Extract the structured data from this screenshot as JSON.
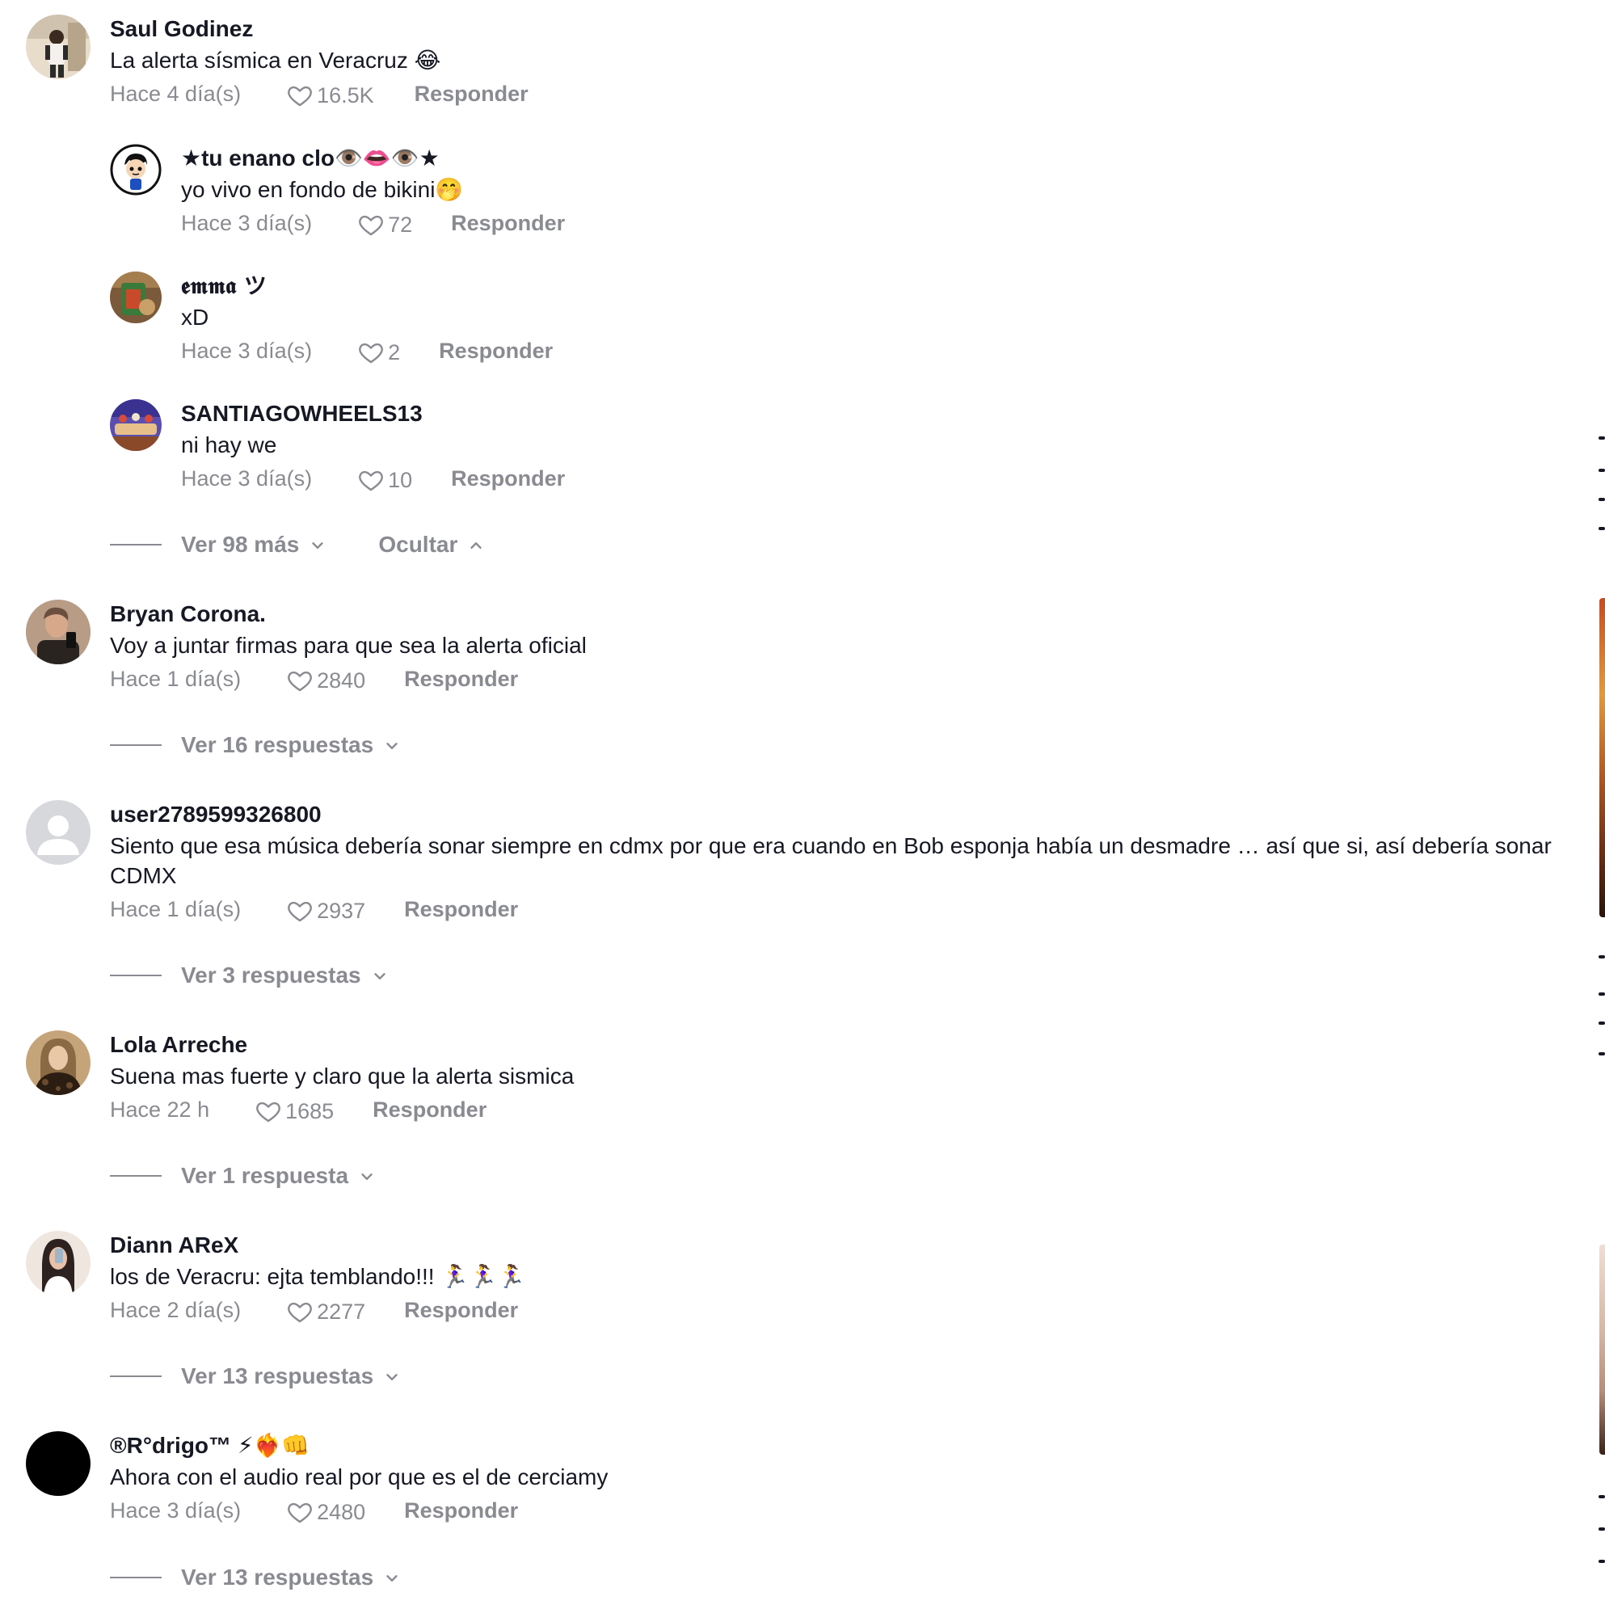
{
  "comments": [
    {
      "username": "Saul Godinez",
      "text": "La alerta sísmica en Veracruz 😂",
      "time": "Hace 4 día(s)",
      "likes": "16.5K",
      "reply_label": "Responder",
      "avatar": {
        "type": "photo",
        "colors": [
          "#d8c3a8",
          "#3b3b3b",
          "#f2efe9"
        ]
      },
      "replies": [
        {
          "username": "★tu enano clo👁️👄👁️★",
          "text": "yo vivo en fondo de bikini🤭",
          "time": "Hace 3 día(s)",
          "likes": "72",
          "reply_label": "Responder",
          "avatar": {
            "type": "cartoon",
            "colors": [
              "#ffffff",
              "#111111",
              "#1d4fbf"
            ]
          }
        },
        {
          "username": "𝖊𝖒𝖒𝖆 ツ",
          "text": "xD",
          "time": "Hace 3 día(s)",
          "likes": "2",
          "reply_label": "Responder",
          "avatar": {
            "type": "photo",
            "colors": [
              "#7a5a3a",
              "#3a7a3a",
              "#c9a06a"
            ]
          }
        },
        {
          "username": "SANTIAGOWHEELS13",
          "text": "ni hay we",
          "time": "Hace 3 día(s)",
          "likes": "10",
          "reply_label": "Responder",
          "avatar": {
            "type": "photo",
            "colors": [
              "#5a4fb0",
              "#d84a3a",
              "#e7c089"
            ]
          }
        }
      ],
      "view_more_label": "Ver 98 más",
      "hide_label": "Ocultar"
    },
    {
      "username": "Bryan Corona.",
      "text": "Voy a juntar firmas para que sea la alerta oficial",
      "time": "Hace 1 día(s)",
      "likes": "2840",
      "reply_label": "Responder",
      "avatar": {
        "type": "photo",
        "colors": [
          "#6b5040",
          "#2a2420",
          "#c9b6a6"
        ]
      },
      "view_replies_label": "Ver 16 respuestas"
    },
    {
      "username": "user2789599326800",
      "text": "Siento que esa música debería sonar siempre en cdmx por que era cuando en Bob esponja había un desmadre … así que si, así debería sonar CDMX",
      "time": "Hace 1 día(s)",
      "likes": "2937",
      "reply_label": "Responder",
      "avatar": {
        "type": "default",
        "colors": [
          "#d7d8db",
          "#ffffff"
        ]
      },
      "view_replies_label": "Ver 3 respuestas"
    },
    {
      "username": "Lola Arreche",
      "text": "Suena mas fuerte y claro que la alerta sismica",
      "time": "Hace 22 h",
      "likes": "1685",
      "reply_label": "Responder",
      "avatar": {
        "type": "photo",
        "colors": [
          "#6a4a2e",
          "#c6a47a",
          "#2b1d12"
        ]
      },
      "view_replies_label": "Ver 1 respuesta"
    },
    {
      "username": "Diann AReX",
      "text": "los de Veracru: ejta temblando!!! 🏃‍♀️🏃‍♀️🏃‍♀️",
      "time": "Hace 2 día(s)",
      "likes": "2277",
      "reply_label": "Responder",
      "avatar": {
        "type": "photo",
        "colors": [
          "#efe6df",
          "#2d2220",
          "#c2958a"
        ]
      },
      "view_replies_label": "Ver 13 respuestas"
    },
    {
      "username": "®R°drigo™ ⚡❤️‍🔥👊",
      "text": "Ahora con el audio real por que es el de cerciamy",
      "time": "Hace 3 día(s)",
      "likes": "2480",
      "reply_label": "Responder",
      "avatar": {
        "type": "solid",
        "colors": [
          "#000000"
        ]
      },
      "view_replies_label": "Ver 13 respuestas"
    }
  ],
  "icons": {
    "like": "heart-outline-icon",
    "expand": "chevron-down-icon",
    "collapse": "chevron-up-icon"
  },
  "colors": {
    "text_primary": "#161823",
    "text_secondary": "#8a8b91",
    "background": "#ffffff"
  }
}
